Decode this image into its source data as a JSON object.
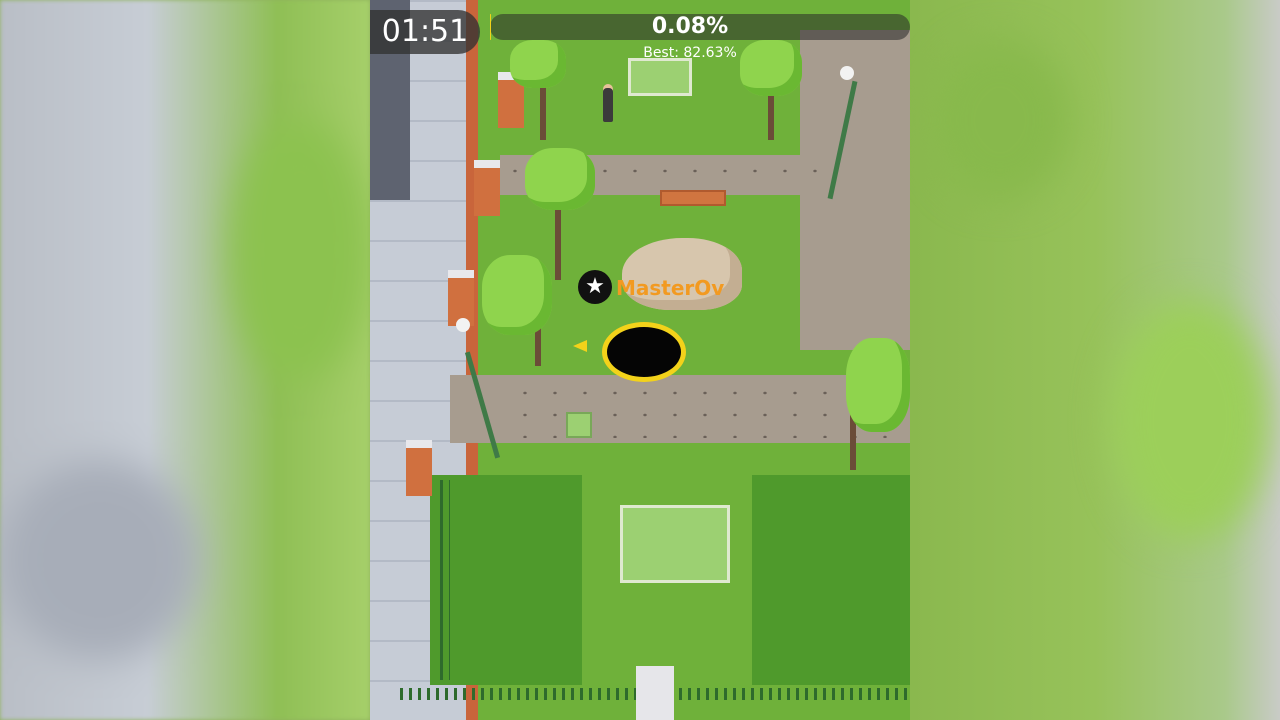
{
  "hud": {
    "timer": "01:51",
    "progress_text": "0.08%",
    "progress_value": 0.0008,
    "best_text": "Best: 82.63%"
  },
  "player": {
    "name": "MasterOv",
    "badge_icon": "star-icon"
  },
  "colors": {
    "hole_ring": "#f3d21a",
    "player_name": "#f29a21",
    "grass": "#6fb13a"
  }
}
